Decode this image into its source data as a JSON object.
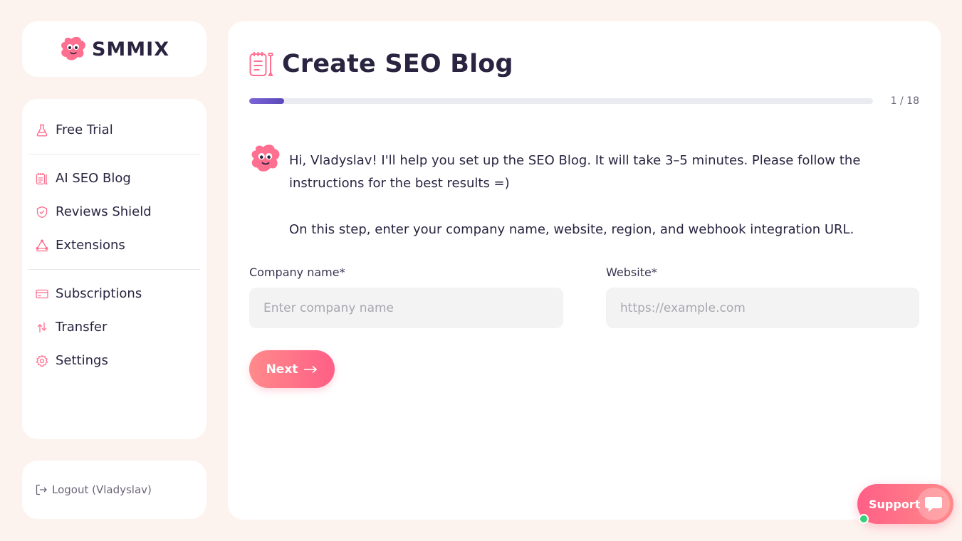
{
  "brand": {
    "name": "SMMIX"
  },
  "nav": {
    "trial": {
      "label": "Free Trial",
      "icon": "flask-icon"
    },
    "group1": [
      {
        "label": "AI SEO Blog",
        "icon": "notepad-icon"
      },
      {
        "label": "Reviews Shield",
        "icon": "shield-icon"
      },
      {
        "label": "Extensions",
        "icon": "extensions-icon"
      }
    ],
    "group2": [
      {
        "label": "Subscriptions",
        "icon": "subscription-icon"
      },
      {
        "label": "Transfer",
        "icon": "transfer-icon"
      },
      {
        "label": "Settings",
        "icon": "gear-icon"
      }
    ]
  },
  "logout": {
    "label": "Logout (Vladyslav)"
  },
  "main": {
    "title": "Create SEO Blog",
    "progress": {
      "current": 1,
      "total": 18,
      "text": "1 / 18"
    },
    "message": {
      "line1": "Hi, Vladyslav! I'll help you set up the SEO Blog. It will take 3–5 minutes. Please follow the instructions for the best results =)",
      "line2": "On this step, enter your company name, website, region, and webhook integration URL."
    },
    "fields": {
      "company": {
        "label": "Company name*",
        "placeholder": "Enter company name",
        "value": ""
      },
      "website": {
        "label": "Website*",
        "placeholder": "https://example.com",
        "value": ""
      }
    },
    "next_label": "Next"
  },
  "support": {
    "label": "Support"
  },
  "colors": {
    "accent": "#ff5f86",
    "progress": "#6a55c8",
    "background": "#fdf3ee"
  }
}
